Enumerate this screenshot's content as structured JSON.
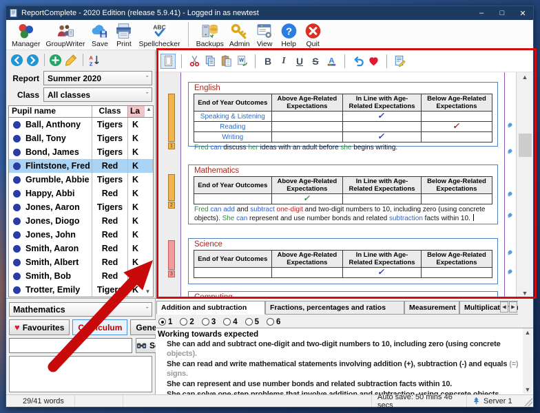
{
  "window": {
    "title": "ReportComplete - 2020 Edition (release 5.9.41) - Logged in as newtest"
  },
  "toolbar": {
    "items": [
      {
        "icon": "manager",
        "label": "Manager"
      },
      {
        "icon": "groupwriter",
        "label": "GroupWriter"
      },
      {
        "icon": "save",
        "label": "Save"
      },
      {
        "icon": "print",
        "label": "Print"
      },
      {
        "icon": "spellchecker",
        "label": "Spellchecker"
      },
      {
        "sep": true
      },
      {
        "icon": "backups",
        "label": "Backups"
      },
      {
        "icon": "admin",
        "label": "Admin"
      },
      {
        "icon": "view",
        "label": "View"
      },
      {
        "icon": "help",
        "label": "Help"
      },
      {
        "icon": "quit",
        "label": "Quit"
      }
    ]
  },
  "nav_toolbar": {
    "items": [
      "back",
      "forward",
      "|",
      "add",
      "edit",
      "|",
      "sort-az"
    ]
  },
  "doc_toolbar": {
    "items": [
      "page-setup",
      "|",
      "cut",
      "copy",
      "paste",
      "paste-word",
      "|",
      "bold",
      "italic",
      "underline",
      "strikethrough",
      "font-color",
      "|",
      "undo",
      "favourite",
      "|",
      "compose"
    ]
  },
  "sidebar": {
    "report_label": "Report",
    "report_value": "Summer 2020",
    "class_label": "Class",
    "class_value": "All classes",
    "columns": {
      "name": "Pupil name",
      "class": "Class",
      "la": "La"
    },
    "pupils": [
      {
        "name": "Ball, Anthony",
        "class": "Tigers",
        "la": "K",
        "selected": false
      },
      {
        "name": "Ball, Tony",
        "class": "Tigers",
        "la": "K",
        "selected": false
      },
      {
        "name": "Bond, James",
        "class": "Tigers",
        "la": "K",
        "selected": false
      },
      {
        "name": "Flintstone, Fred",
        "class": "Red",
        "la": "K",
        "selected": true
      },
      {
        "name": "Grumble, Abbie",
        "class": "Tigers",
        "la": "K",
        "selected": false
      },
      {
        "name": "Happy, Abbi",
        "class": "Red",
        "la": "K",
        "selected": false
      },
      {
        "name": "Jones, Aaron",
        "class": "Tigers",
        "la": "K",
        "selected": false
      },
      {
        "name": "Jones, Diogo",
        "class": "Red",
        "la": "K",
        "selected": false
      },
      {
        "name": "Jones, John",
        "class": "Red",
        "la": "K",
        "selected": false
      },
      {
        "name": "Smith, Aaron",
        "class": "Red",
        "la": "K",
        "selected": false
      },
      {
        "name": "Smith, Albert",
        "class": "Red",
        "la": "K",
        "selected": false
      },
      {
        "name": "Smith, Bob",
        "class": "Red",
        "la": "K",
        "selected": false
      },
      {
        "name": "Trotter, Emily",
        "class": "Tigers",
        "la": "K",
        "selected": false
      }
    ]
  },
  "bank": {
    "subject": "Mathematics",
    "favourites_label": "Favourites",
    "curriculum_label": "Curriculum",
    "general_label": "General",
    "active_button": "Curriculum",
    "search_value": "",
    "search_label": "Search"
  },
  "document": {
    "columns": [
      "End of Year Outcomes",
      "Above Age-Related Expectations",
      "In Line with Age-Related Expectations",
      "Below Age-Related Expectations"
    ],
    "sections": [
      {
        "title": "English",
        "rows": [
          {
            "label": "Speaking & Listening",
            "tick": "inline",
            "tick_color": "#2233bb"
          },
          {
            "label": "Reading",
            "tick": "below",
            "tick_color": "#9e1a1a"
          },
          {
            "label": "Writing",
            "tick": "inline",
            "tick_color": "#2233bb"
          }
        ],
        "sentence": [
          [
            "Fred",
            "g"
          ],
          [
            " can",
            "b"
          ],
          [
            " discuss ",
            "k"
          ],
          [
            "her",
            "g"
          ],
          [
            " ideas with an adult before ",
            "k"
          ],
          [
            "she",
            "g"
          ],
          [
            " begins writing.",
            "k"
          ]
        ],
        "marker": {
          "tag": "1",
          "color": "#f2b54b",
          "border": "#a8762a"
        }
      },
      {
        "title": "Mathematics",
        "rows": [
          {
            "label": "",
            "tick": "above",
            "tick_color": "#1f9d2f"
          }
        ],
        "sentence": [
          [
            "Fred",
            "g"
          ],
          [
            " can add",
            "b"
          ],
          [
            " and ",
            "k"
          ],
          [
            "subtract",
            "b"
          ],
          [
            " one-digit",
            "r"
          ],
          [
            " and two-digit numbers to 10, including zero (using concrete objects).  ",
            "k"
          ],
          [
            "She",
            "g"
          ],
          [
            " can",
            "b"
          ],
          [
            " represent and use number bonds and related ",
            "k"
          ],
          [
            "subtraction",
            "b"
          ],
          [
            " facts within 10. ",
            "k"
          ]
        ],
        "cursor": true,
        "marker": {
          "tag": "2",
          "color": "#f2b54b",
          "border": "#a8762a"
        }
      },
      {
        "title": "Science",
        "rows": [
          {
            "label": "",
            "tick": "inline",
            "tick_color": "#2233bb"
          }
        ],
        "sentence": [],
        "marker": {
          "tag": "3",
          "color": "#f49a9a",
          "border": "#b85c5c"
        }
      },
      {
        "title": "Computing",
        "rows": [],
        "sentence": []
      }
    ]
  },
  "statements_panel": {
    "tabs": [
      "Addition and subtraction",
      "Fractions, percentages and ratios",
      "Measurement",
      "Multiplication and divis"
    ],
    "active_tab": "Addition and subtraction",
    "levels": [
      "1",
      "2",
      "3",
      "4",
      "5",
      "6"
    ],
    "selected_level": "1",
    "heading": "Working towards expected",
    "statements": [
      {
        "main": "She can add and subtract one-digit and two-digit numbers to 10, including zero (using concrete",
        "tail": " objects)."
      },
      {
        "main": "She can read and write mathematical statements involving addition (+), subtraction (-) and equals",
        "tail": " (=) signs."
      },
      {
        "main": "She can represent and use number bonds and related subtraction facts within 10.",
        "tail": ""
      },
      {
        "main": "She can solve one-step problems that involve addition and subtraction, using concrete objects",
        "tail": ""
      }
    ]
  },
  "statusbar": {
    "words": "29/41 words",
    "autosave": "Auto save: 50 mins 46 secs",
    "server": "Server 1"
  }
}
